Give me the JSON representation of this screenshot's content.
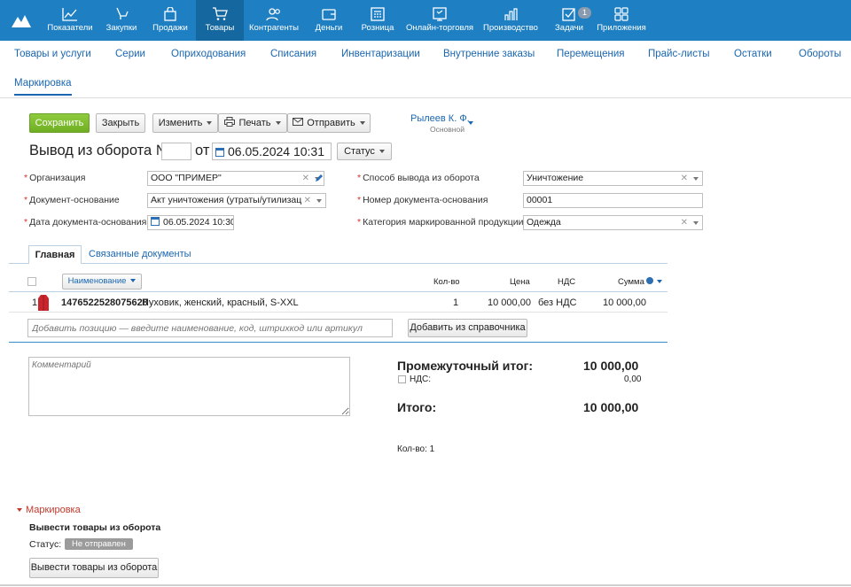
{
  "nav": [
    {
      "label": "Показатели",
      "icon": "chart-line-icon"
    },
    {
      "label": "Закупки",
      "icon": "purchases-icon"
    },
    {
      "label": "Продажи",
      "icon": "shopping-bag-icon"
    },
    {
      "label": "Товары",
      "icon": "shopping-cart-icon",
      "active": true
    },
    {
      "label": "Контрагенты",
      "icon": "people-icon"
    },
    {
      "label": "Деньги",
      "icon": "wallet-icon"
    },
    {
      "label": "Розница",
      "icon": "cash-register-icon"
    },
    {
      "label": "Онлайн-торговля",
      "icon": "online-store-icon"
    },
    {
      "label": "Производство",
      "icon": "production-chart-icon"
    },
    {
      "label": "Задачи",
      "icon": "task-check-icon",
      "badge": "1"
    },
    {
      "label": "Приложения",
      "icon": "apps-grid-icon"
    }
  ],
  "subnav": {
    "row1": [
      "Товары и услуги",
      "Серии",
      "Оприходования",
      "Списания",
      "Инвентаризации",
      "Внутренние заказы",
      "Перемещения",
      "Прайс-листы",
      "Остатки",
      "Обороты"
    ],
    "row2": [
      "Маркировка"
    ]
  },
  "toolbar": {
    "save": "Сохранить",
    "close": "Закрыть",
    "edit": "Изменить",
    "print": "Печать",
    "send": "Отправить",
    "user_name": "Рылеев К. Ф.",
    "user_role": "Основной"
  },
  "doc": {
    "title": "Вывод из оборота №",
    "number": "",
    "from": "от",
    "date": "06.05.2024 10:31",
    "status": "Статус"
  },
  "form": {
    "org_label": "Организация",
    "org_value": "ООО \"ПРИМЕР\"",
    "basis_label": "Документ-основание",
    "basis_value": "Акт уничтожения (утраты/утилизаци",
    "basis_date_label": "Дата документа-основания",
    "basis_date_value": "06.05.2024 10:30",
    "method_label": "Способ вывода из оборота",
    "method_value": "Уничтожение",
    "basis_num_label": "Номер документа-основания",
    "basis_num_value": "00001",
    "category_label": "Категория маркированной продукции",
    "category_value": "Одежда"
  },
  "tabs": {
    "main": "Главная",
    "related": "Связанные документы"
  },
  "table": {
    "headers": {
      "name": "Наименование",
      "qty": "Кол-во",
      "price": "Цена",
      "vat": "НДС",
      "sum": "Сумма"
    },
    "rows": [
      {
        "num": "1",
        "code": "1476522528075628",
        "name": "Пуховик, женский, красный, S-XXL",
        "qty": "1",
        "price": "10 000,00",
        "vat": "без НДС",
        "sum": "10 000,00"
      }
    ],
    "add_placeholder": "Добавить позицию — введите наименование, код, штрихкод или артикул",
    "add_from_catalog": "Добавить из справочника"
  },
  "comment_placeholder": "Комментарий",
  "totals": {
    "subtotal_label": "Промежуточный итог:",
    "subtotal_value": "10 000,00",
    "vat_label": "НДС:",
    "vat_value": "0,00",
    "total_label": "Итого:",
    "total_value": "10 000,00",
    "qty_label": "Кол-во: 1"
  },
  "marking": {
    "section": "Маркировка",
    "heading": "Вывести товары из оборота",
    "status_label": "Статус:",
    "status_value": "Не отправлен",
    "action": "Вывести товары из оборота"
  }
}
